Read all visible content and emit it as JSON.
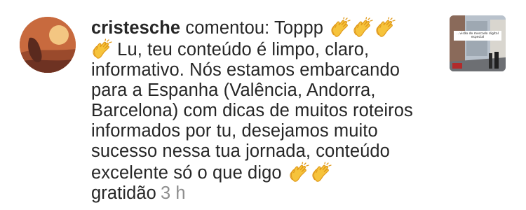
{
  "notification": {
    "username": "cristesche",
    "action_text": " comentou: Toppp",
    "comment_lines": [
      " Lu, teu conteúdo é limpo, claro,",
      "informativo. Nós estamos embarcando",
      "para a Espanha (Valência, Andorra,",
      "Barcelona) com dicas de muitos roteiros",
      "informados por tu, desejamos muito",
      "sucesso nessa tua jornada, conteúdo",
      "excelente  só o que digo"
    ],
    "last_line": "gratidão",
    "timestamp": "3 h",
    "icons": {
      "clap": "clapping-hands-emoji",
      "avatar": "profile-photo-sunset",
      "thumbnail": "post-thumbnail-street"
    },
    "thumbnail_caption": "...visão de mercado digital especial",
    "colors": {
      "text": "#262626",
      "timestamp": "#8e8e8e",
      "clap_fill": "#f6c33b",
      "clap_shade": "#e09a1c"
    }
  }
}
